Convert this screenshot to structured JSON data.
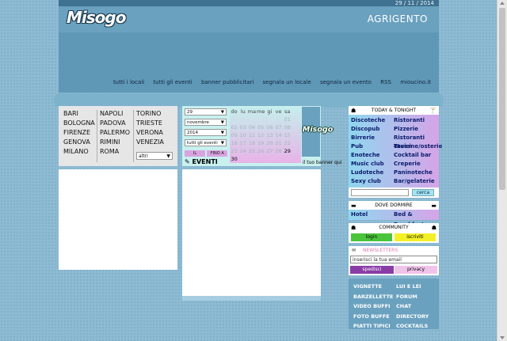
{
  "header": {
    "date": "29 / 11 / 2014",
    "logo": "Misogo",
    "city": "AGRIGENTO",
    "links": [
      "tutti i locali",
      "tutti gli eventi",
      "banner pubblicitari",
      "segnala un locale",
      "segnala un evento",
      "RSS",
      "mioucino.it"
    ]
  },
  "cities": {
    "col1": [
      "BARI",
      "BOLOGNA",
      "FIRENZE",
      "GENOVA",
      "MILANO"
    ],
    "col2": [
      "NAPOLI",
      "PADOVA",
      "PALERMO",
      "RIMINI",
      "ROMA"
    ],
    "col3": [
      "TORINO",
      "TRIESTE",
      "VERONA",
      "VENEZIA"
    ],
    "other_select": "altri"
  },
  "calendar": {
    "day_select": "29",
    "month_select": "novembre",
    "year_select": "2014",
    "type_select": "tutti gli eventi",
    "btn_from": "IL",
    "btn_to": "FINO A",
    "eventi_label": "EVENTI",
    "weekdays": [
      "do",
      "lu",
      "ma",
      "me",
      "gi",
      "ve",
      "sa"
    ],
    "weeks": [
      [
        "",
        "",
        "",
        "",
        "",
        "",
        "01"
      ],
      [
        "02",
        "03",
        "04",
        "05",
        "06",
        "07",
        "08"
      ],
      [
        "09",
        "10",
        "11",
        "12",
        "13",
        "14",
        "15"
      ],
      [
        "16",
        "17",
        "18",
        "19",
        "20",
        "21",
        "22"
      ],
      [
        "23",
        "24",
        "25",
        "26",
        "27",
        "28",
        "29"
      ],
      [
        "30",
        "",
        "",
        "",
        "",
        "",
        ""
      ]
    ],
    "banner_logo": "Misogo",
    "banner_label": "il tuo banner qui"
  },
  "right": {
    "today_title": "TODAY & TONIGHT",
    "today_items": [
      [
        "Discoteche",
        "Ristoranti"
      ],
      [
        "Discopub",
        "Pizzerie"
      ],
      [
        "Birrerie",
        "Ristoranti etnici"
      ],
      [
        "Pub",
        "Taverne/osterie"
      ],
      [
        "Enoteche",
        "Cocktail bar"
      ],
      [
        "Music club",
        "Creperie"
      ],
      [
        "Ludoteche",
        "Paninoteche"
      ],
      [
        "Sexy club",
        "Bar/gelaterie"
      ]
    ],
    "search_button": "cerca",
    "sleep_title": "DOVE DORMIRE",
    "sleep_items": [
      "Hotel",
      "Bed & Breakfast"
    ],
    "community_title": "COMMUNITY",
    "login": "login",
    "iscriviti": "iscriviti",
    "newsletter_title": "NEWSLETTERS",
    "newsletter_placeholder": "inserisci la tua email",
    "spedisci": "spedisci",
    "privacy": "privacy",
    "fun_items": [
      [
        "VIGNETTE",
        "LUI E LEI"
      ],
      [
        "BARZELLETTE",
        "FORUM"
      ],
      [
        "VIDEO BUFFI",
        "CHAT"
      ],
      [
        "FOTO BUFFE",
        "DIRECTORY"
      ],
      [
        "PIATTI TIPICI",
        "COCKTAILS"
      ]
    ]
  }
}
